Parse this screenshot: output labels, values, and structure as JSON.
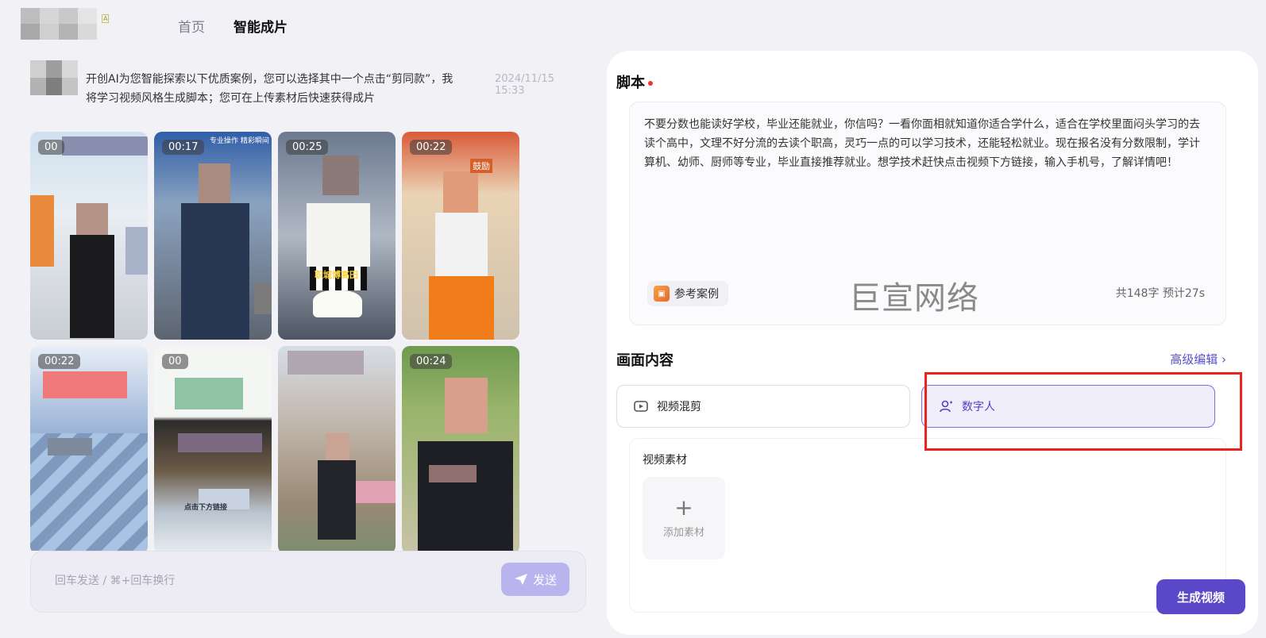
{
  "nav": {
    "home": "首页",
    "smart": "智能成片"
  },
  "chat": {
    "message": "开创AI为您智能探索以下优质案例，您可以选择其中一个点击“剪同款”，我将学习视频风格生成脚本；您可在上传素材后快速获得成片",
    "time": "2024/11/15 15:33"
  },
  "videos": [
    {
      "duration": "00",
      "caption": ""
    },
    {
      "duration": "00:17",
      "caption": "专业操作  精彩瞬间"
    },
    {
      "duration": "00:25",
      "caption": "职城博高田"
    },
    {
      "duration": "00:22",
      "caption": "鼓励"
    },
    {
      "duration": "00:22",
      "caption": ""
    },
    {
      "duration": "00",
      "caption": "点击下方链接"
    },
    {
      "duration": "",
      "caption": ""
    },
    {
      "duration": "00:24",
      "caption": ""
    }
  ],
  "input": {
    "placeholder": "回车发送 / ⌘+回车换行",
    "send": "发送"
  },
  "script": {
    "title": "脚本",
    "text": "不要分数也能读好学校，毕业还能就业，你信吗？一看你面相就知道你适合学什么，适合在学校里面闷头学习的去读个高中，文理不好分流的去读个职高，灵巧一点的可以学习技术，还能轻松就业。现在报名没有分数限制，学计算机、幼师、厨师等专业，毕业直接推荐就业。想学技术赶快点击视频下方链接，输入手机号，了解详情吧！",
    "ref": "参考案例",
    "watermark": "巨宣网络",
    "count": "共148字  预计27s"
  },
  "content": {
    "title": "画面内容",
    "advanced": "高级编辑 ›",
    "option_mix": "视频混剪",
    "option_digital": "数字人",
    "material_label": "视频素材",
    "add_material": "添加素材"
  },
  "generate": "生成视频",
  "colors": {
    "accent": "#5a48c8",
    "highlight": "#e8241c",
    "selected_bg": "#f1eefc"
  }
}
